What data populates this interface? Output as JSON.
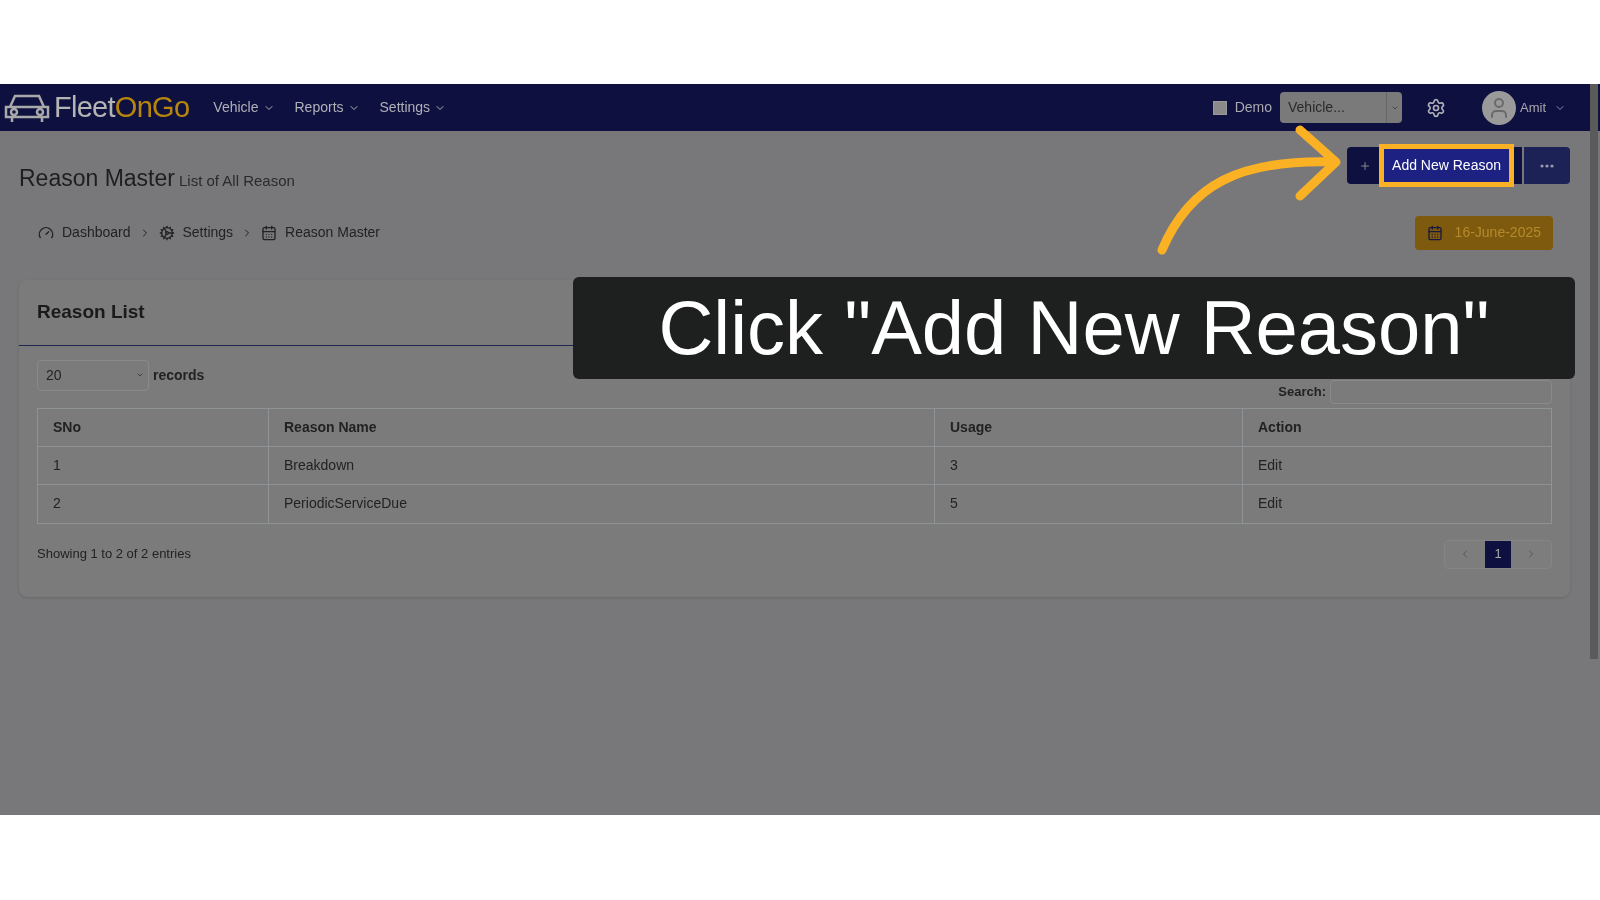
{
  "navbar": {
    "logo": {
      "text_1": "Fleet",
      "text_2": "OnGo"
    },
    "menus": [
      {
        "label": "Vehicle"
      },
      {
        "label": "Reports"
      },
      {
        "label": "Settings"
      }
    ],
    "demo": {
      "label": "Demo",
      "checked": false
    },
    "vehicle_select": {
      "value": "Vehicle..."
    },
    "user": {
      "name": "Amit"
    }
  },
  "header": {
    "title": "Reason Master",
    "subtitle": "List of All Reason",
    "add_button": "Add New Reason",
    "breadcrumb": [
      {
        "label": "Dashboard"
      },
      {
        "label": "Settings"
      },
      {
        "label": "Reason Master"
      }
    ],
    "date": "16-June-2025"
  },
  "card": {
    "title": "Reason List",
    "page_size": "20",
    "records_label": "records",
    "search_label": "Search:",
    "table": {
      "columns": [
        "SNo",
        "Reason Name",
        "Usage",
        "Action"
      ],
      "rows": [
        [
          "1",
          "Breakdown",
          "3",
          "Edit"
        ],
        [
          "2",
          "PeriodicServiceDue",
          "5",
          "Edit"
        ]
      ]
    },
    "info": "Showing 1 to 2 of 2 entries",
    "pages": [
      {
        "label": "1",
        "selected": true
      }
    ]
  },
  "callout": {
    "text": "Click \"Add New Reason\""
  }
}
